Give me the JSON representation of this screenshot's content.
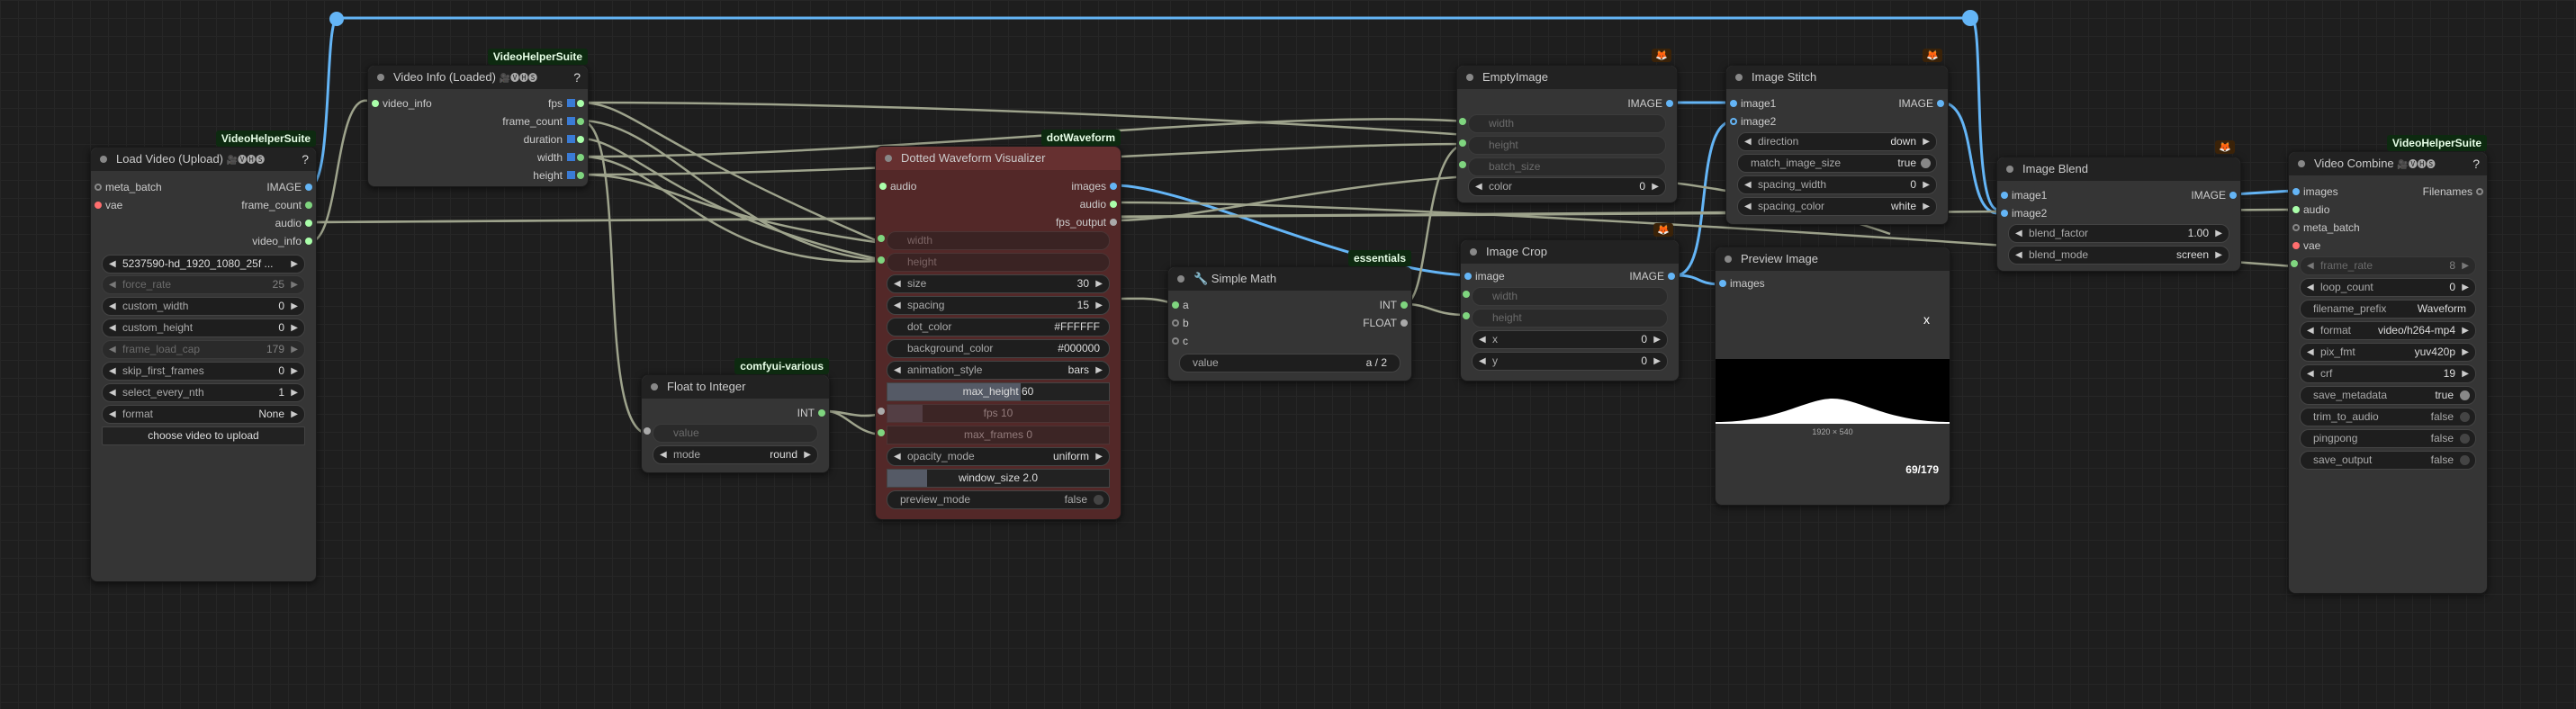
{
  "colors": {
    "link_int": "#9ea38c",
    "link_image": "#64b5f6",
    "link_audio": "#8aa27a",
    "sock_image": "#64b5f6",
    "sock_vae": "#ff6e6e",
    "sock_int": "#7fd57f",
    "sock_audio": "#aaffaa",
    "sock_float": "#aaaaaa"
  },
  "load_video": {
    "badge": "VideoHelperSuite",
    "title": "Load Video (Upload)",
    "icons": "🎥🅥🅗🅢",
    "help": "?",
    "inputs": [
      "meta_batch",
      "vae"
    ],
    "outputs": [
      "IMAGE",
      "frame_count",
      "audio",
      "video_info"
    ],
    "video": "5237590-hd_1920_1080_25f ...",
    "w": [
      {
        "l": "force_rate",
        "v": "25"
      },
      {
        "l": "custom_width",
        "v": "0"
      },
      {
        "l": "custom_height",
        "v": "0"
      },
      {
        "l": "frame_load_cap",
        "v": "179"
      },
      {
        "l": "skip_first_frames",
        "v": "0"
      },
      {
        "l": "select_every_nth",
        "v": "1"
      },
      {
        "l": "format",
        "v": "None"
      }
    ],
    "upload": "choose video to upload"
  },
  "video_info": {
    "badge": "VideoHelperSuite",
    "title": "Video Info (Loaded)",
    "icons": "🎥🅥🅗🅢",
    "help": "?",
    "input": "video_info",
    "outputs": [
      "fps",
      "frame_count",
      "duration",
      "width",
      "height"
    ]
  },
  "dotted": {
    "badge": "dotWaveform",
    "title": "Dotted Waveform Visualizer",
    "input": "audio",
    "inputs2": [
      "width",
      "height"
    ],
    "outputs": [
      "images",
      "audio",
      "fps_output"
    ],
    "w": [
      {
        "l": "size",
        "v": "30"
      },
      {
        "l": "spacing",
        "v": "15"
      },
      {
        "l": "dot_color",
        "v": "#FFFFFF"
      },
      {
        "l": "background_color",
        "v": "#000000"
      },
      {
        "l": "animation_style",
        "v": "bars"
      }
    ],
    "max_height": "max_height  60",
    "max_height_level": 0.6,
    "fps": "fps  10",
    "fps_level": 0.16,
    "max_frames": "max_frames  0",
    "opacity_l": "opacity_mode",
    "opacity_v": "uniform",
    "window": "window_size  2.0",
    "window_level": 0.18,
    "preview_l": "preview_mode",
    "preview_v": "false"
  },
  "float_int": {
    "badge": "comfyui-various",
    "title": "Float to Integer",
    "output": "INT",
    "input": "value",
    "mode_l": "mode",
    "mode_v": "round"
  },
  "simple_math": {
    "badge": "essentials",
    "title": "🔧 Simple Math",
    "inputs": [
      "a",
      "b",
      "c"
    ],
    "outputs": [
      "INT",
      "FLOAT"
    ],
    "value_l": "value",
    "value_v": "a / 2"
  },
  "empty_image": {
    "title": "EmptyImage",
    "output": "IMAGE",
    "inputs": [
      "width",
      "height",
      "batch_size"
    ],
    "color_l": "color",
    "color_v": "0"
  },
  "image_crop": {
    "title": "Image Crop",
    "input": "image",
    "output": "IMAGE",
    "inputs2": [
      "width",
      "height"
    ],
    "x_l": "x",
    "x_v": "0",
    "y_l": "y",
    "y_v": "0"
  },
  "image_stitch": {
    "title": "Image Stitch",
    "inputs": [
      "image1",
      "image2"
    ],
    "output": "IMAGE",
    "direction_l": "direction",
    "direction_v": "down",
    "match_l": "match_image_size",
    "match_v": "true",
    "spw_l": "spacing_width",
    "spw_v": "0",
    "spc_l": "spacing_color",
    "spc_v": "white"
  },
  "preview": {
    "title": "Preview Image",
    "input": "images",
    "close": "x",
    "dims": "1920 × 540",
    "counter": "69/179"
  },
  "image_blend": {
    "title": "Image Blend",
    "inputs": [
      "image1",
      "image2"
    ],
    "output": "IMAGE",
    "bf_l": "blend_factor",
    "bf_v": "1.00",
    "bm_l": "blend_mode",
    "bm_v": "screen"
  },
  "video_combine": {
    "badge": "VideoHelperSuite",
    "title": "Video Combine",
    "icons": "🎥🅥🅗🅢",
    "help": "?",
    "inputs": [
      "images",
      "audio",
      "meta_batch",
      "vae"
    ],
    "output": "Filenames",
    "w": [
      {
        "l": "frame_rate",
        "v": "8"
      },
      {
        "l": "loop_count",
        "v": "0"
      },
      {
        "l": "filename_prefix",
        "v": "Waveform"
      },
      {
        "l": "format",
        "v": "video/h264-mp4"
      },
      {
        "l": "pix_fmt",
        "v": "yuv420p"
      },
      {
        "l": "crf",
        "v": "19"
      }
    ],
    "t": [
      {
        "l": "save_metadata",
        "v": "true"
      },
      {
        "l": "trim_to_audio",
        "v": "false"
      },
      {
        "l": "pingpong",
        "v": "false"
      },
      {
        "l": "save_output",
        "v": "false"
      }
    ]
  }
}
